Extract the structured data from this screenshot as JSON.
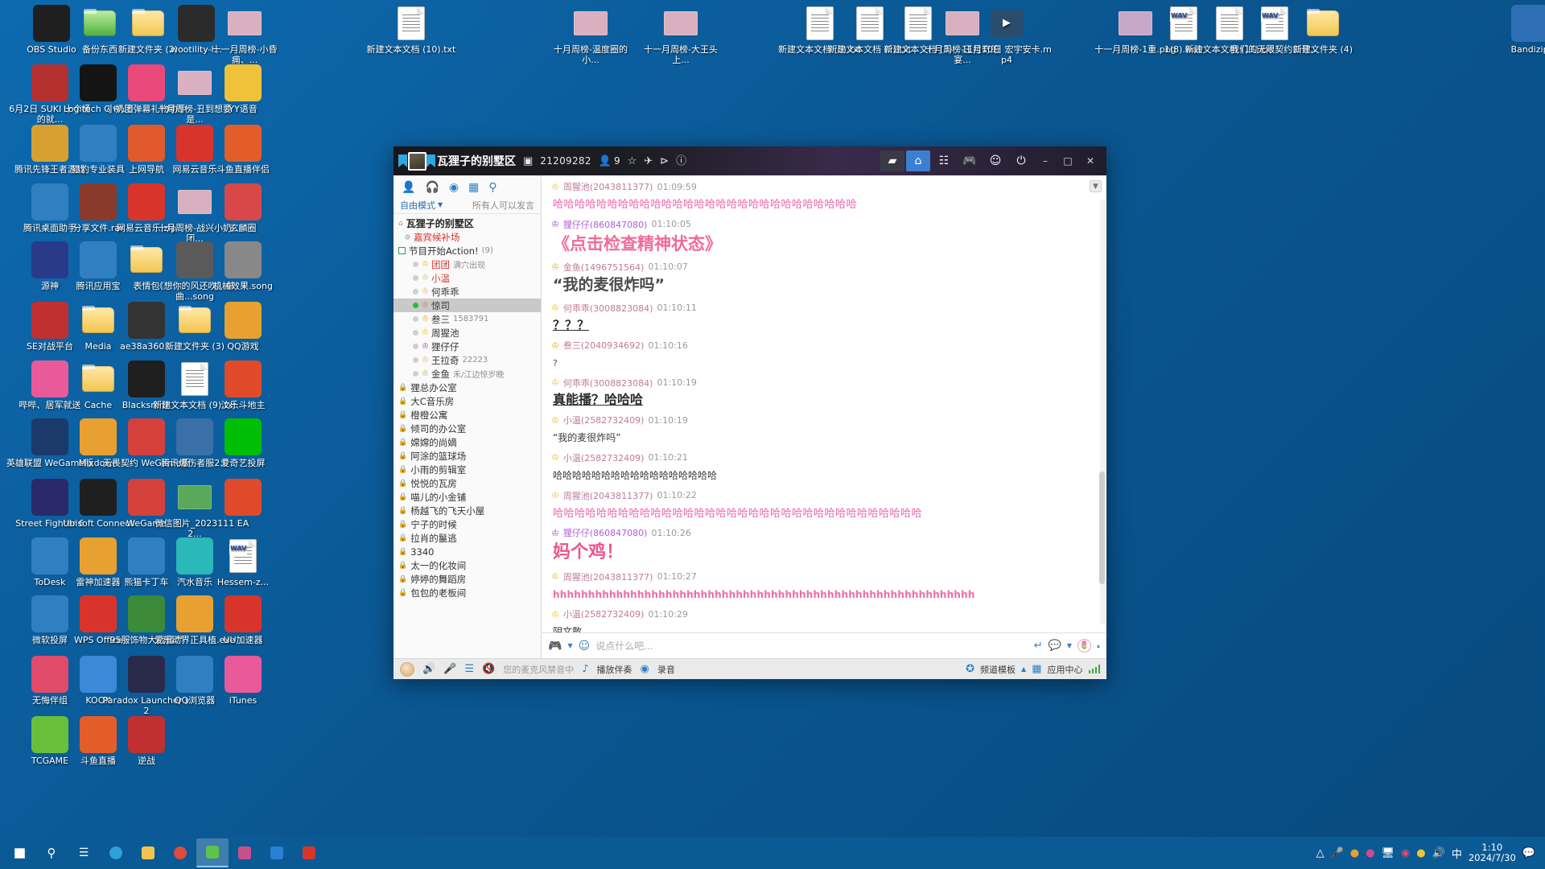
{
  "desktop": {
    "icons": [
      {
        "label": "OBS Studio",
        "type": "app",
        "color": "#1f1f1f"
      },
      {
        "label": "备份东西",
        "type": "folder-green"
      },
      {
        "label": "新建文件夹 (2)",
        "type": "folder"
      },
      {
        "label": "wootility-l...",
        "type": "app",
        "color": "#2b2b2b"
      },
      {
        "label": "十一月周榜-小昏痈、...",
        "type": "image",
        "color": "#d8b0c0"
      },
      {
        "label": "新建文本文档 (10).txt",
        "type": "txt"
      },
      {
        "label": "十月周榜-温度圈的小...",
        "type": "image",
        "color": "#d8b0c0"
      },
      {
        "label": "十一月周榜-大王头上...",
        "type": "image",
        "color": "#d8b0c0"
      },
      {
        "label": "新建文本文档 (5).txt",
        "type": "txt"
      },
      {
        "label": "新建文本文档 (2).txt",
        "type": "txt"
      },
      {
        "label": "新建文本文档 (3)",
        "type": "txt"
      },
      {
        "label": "十月周榜-王拉奇的宴...",
        "type": "image",
        "color": "#d8b0c0"
      },
      {
        "label": "11月10日 宏宇安卡.mp4",
        "type": "video",
        "color": "#2a4d6e"
      },
      {
        "label": "十一月周榜-1重.png",
        "type": "image",
        "color": "#c8a8c8"
      },
      {
        "label": "1(8).wav",
        "type": "wav"
      },
      {
        "label": "新建文本文档 (11).txt",
        "type": "txt"
      },
      {
        "label": "我们的无限契约口号...",
        "type": "wav"
      },
      {
        "label": "新建文件夹 (4)",
        "type": "folder"
      },
      {
        "label": "Bandizip",
        "type": "app",
        "color": "#2e6fb5"
      },
      {
        "label": "6月2日 SUKI 十个桶的就...",
        "type": "app",
        "color": "#b43030"
      },
      {
        "label": "Logitech G HUB",
        "type": "app",
        "color": "#141414"
      },
      {
        "label": "小奶团弹幕礼物助手",
        "type": "app",
        "color": "#e8487a"
      },
      {
        "label": "十月周榜-丑到想要是...",
        "type": "image",
        "color": "#d8b0c0"
      },
      {
        "label": "YY语音",
        "type": "app",
        "color": "#f0c23a"
      },
      {
        "label": "腾讯先锋王者游戏",
        "type": "app",
        "color": "#d8a030"
      },
      {
        "label": "猎豹专业装具",
        "type": "app",
        "color": "#2f7fc1"
      },
      {
        "label": "上网导航",
        "type": "app",
        "color": "#e05a2b"
      },
      {
        "label": "网易云音乐",
        "type": "app",
        "color": "#d9342b"
      },
      {
        "label": "斗鱼直播伴侣",
        "type": "app",
        "color": "#e35d2b"
      },
      {
        "label": "腾讯桌面助手",
        "type": "app",
        "color": "#2f7fc1"
      },
      {
        "label": "分享文件.rar",
        "type": "app",
        "color": "#8a3a2a"
      },
      {
        "label": "网易云音乐.zip",
        "type": "app",
        "color": "#d9342b"
      },
      {
        "label": "十月周榜-战兴小奶团...",
        "type": "image",
        "color": "#d8b0c0"
      },
      {
        "label": "玄麟圈",
        "type": "app",
        "color": "#d94848"
      },
      {
        "label": "源神",
        "type": "app",
        "color": "#2a3a8a"
      },
      {
        "label": "腾讯应用宝",
        "type": "app",
        "color": "#2f7fc1"
      },
      {
        "label": "表情包",
        "type": "folder"
      },
      {
        "label": "《想你的风还吹》单曲...song",
        "type": "app",
        "color": "#5a5a5a"
      },
      {
        "label": "机械效果.song",
        "type": "app",
        "color": "#888"
      },
      {
        "label": "SE对战平台",
        "type": "app",
        "color": "#c03030"
      },
      {
        "label": "Media",
        "type": "folder"
      },
      {
        "label": "ae38a360...",
        "type": "app",
        "color": "#333"
      },
      {
        "label": "新建文件夹 (3)",
        "type": "folder"
      },
      {
        "label": "QQ游戏",
        "type": "app",
        "color": "#e8a030"
      },
      {
        "label": "哔哔、居军就送",
        "type": "app",
        "color": "#e85a9a"
      },
      {
        "label": "Cache",
        "type": "folder"
      },
      {
        "label": "Blacksmith",
        "type": "app",
        "color": "#1f1f1f"
      },
      {
        "label": "新建文本文档 (9).txt",
        "type": "txt"
      },
      {
        "label": "汶乐斗地主",
        "type": "app",
        "color": "#e04a2b"
      },
      {
        "label": "英雄联盟 WeGame版",
        "type": "app",
        "color": "#1b3a6b"
      },
      {
        "label": "Mixdown",
        "type": "app",
        "color": "#e8a030"
      },
      {
        "label": "无畏契约 WeGame版",
        "type": "app",
        "color": "#d4403c"
      },
      {
        "label": "腾讯爆伤者服2.0",
        "type": "app",
        "color": "#3a6fa8"
      },
      {
        "label": "爱奇艺投屏",
        "type": "app",
        "color": "#00be06"
      },
      {
        "label": "Street Fighter 6",
        "type": "app",
        "color": "#2a2a6a"
      },
      {
        "label": "Ubisoft Connect",
        "type": "app",
        "color": "#1f1f1f"
      },
      {
        "label": "WeGame",
        "type": "app",
        "color": "#d4403c"
      },
      {
        "label": "微信图片_20231112...",
        "type": "image",
        "color": "#5aa85a"
      },
      {
        "label": "EA",
        "type": "app",
        "color": "#e04a2b"
      },
      {
        "label": "ToDesk",
        "type": "app",
        "color": "#2f7fc1"
      },
      {
        "label": "雷神加速器",
        "type": "app",
        "color": "#e8a030"
      },
      {
        "label": "熊猫卡丁车",
        "type": "app",
        "color": "#2f7fc1"
      },
      {
        "label": "汽水音乐",
        "type": "app",
        "color": "#2ab8b8"
      },
      {
        "label": "Hessem-z...",
        "type": "wav"
      },
      {
        "label": "微软投屏",
        "type": "app",
        "color": "#2f7fc1"
      },
      {
        "label": "WPS Office",
        "type": "app",
        "color": "#d9342b"
      },
      {
        "label": "95服饰物大战僵尸",
        "type": "app",
        "color": "#3a8a3a"
      },
      {
        "label": "爱乐动界正具植.exe",
        "type": "app",
        "color": "#e8a030"
      },
      {
        "label": "UU加速器",
        "type": "app",
        "color": "#d9342b"
      },
      {
        "label": "无悔伴组",
        "type": "app",
        "color": "#e04a6b"
      },
      {
        "label": "KOOK",
        "type": "app",
        "color": "#3a8ad8"
      },
      {
        "label": "Paradox Launcher v2",
        "type": "app",
        "color": "#2a2a4a"
      },
      {
        "label": "QQ浏览器",
        "type": "app",
        "color": "#2f7fc1"
      },
      {
        "label": "iTunes",
        "type": "app",
        "color": "#e85a9a"
      },
      {
        "label": "TCGAME",
        "type": "app",
        "color": "#6abf3a"
      },
      {
        "label": "斗鱼直播",
        "type": "app",
        "color": "#e35d2b"
      },
      {
        "label": "逆战",
        "type": "app",
        "color": "#c03030"
      }
    ]
  },
  "app": {
    "titlebar": {
      "room_name": "瓦狸子的别墅区",
      "room_id": "21209282",
      "member_icon": "person-icon",
      "member_count": "9",
      "icons": [
        "id-card-icon",
        "star-icon",
        "airplane-icon",
        "share-icon",
        "info-icon"
      ],
      "right_icons": [
        "screen-share-icon",
        "home-icon",
        "list-icon",
        "game-icon",
        "mask-icon",
        "power-icon"
      ],
      "window_controls": [
        "minimize",
        "maximize",
        "close"
      ]
    },
    "left_panel": {
      "tools": [
        "person-icon",
        "headphone-icon",
        "location-icon",
        "card-icon",
        "search-icon"
      ],
      "mode_label": "自由模式",
      "permission_label": "所有人可以发言",
      "tree": [
        {
          "level": 0,
          "name": "瓦狸子的别墅区",
          "style": "title",
          "marker": "home"
        },
        {
          "level": 1,
          "name": "嘉宾候补场",
          "style": "red",
          "marker": "dot"
        },
        {
          "level": 0,
          "name": "节目开始Action!",
          "style": "dark",
          "marker": "square",
          "suffix": "(9)"
        },
        {
          "level": 2,
          "name": "团团",
          "style": "red",
          "marker": "dot",
          "crown": "yellow",
          "tags": "满穴出现"
        },
        {
          "level": 2,
          "name": "小温",
          "style": "red",
          "marker": "dot",
          "crown": "yellow"
        },
        {
          "level": 2,
          "name": "何乖乖",
          "style": "dark",
          "marker": "dot",
          "crown": "yellow"
        },
        {
          "level": 2,
          "name": "惊司",
          "style": "dark",
          "marker": "dot-on",
          "crown": "orange",
          "selected": true
        },
        {
          "level": 2,
          "name": "叁三",
          "style": "dark",
          "marker": "dot",
          "crown": "gold",
          "suffix": "1583791"
        },
        {
          "level": 2,
          "name": "周猩池",
          "style": "dark",
          "marker": "dot",
          "crown": "yellow"
        },
        {
          "level": 2,
          "name": "狸仔仔",
          "style": "dark",
          "marker": "dot",
          "crown": "purple"
        },
        {
          "level": 2,
          "name": "王拉奇",
          "style": "dark",
          "marker": "dot",
          "crown": "yellow",
          "suffix": "22223"
        },
        {
          "level": 2,
          "name": "金鱼",
          "style": "dark",
          "marker": "dot",
          "crown": "gold",
          "suffix": "禾/江边惊岁晚"
        },
        {
          "level": 0,
          "name": "狸总办公室",
          "style": "dark",
          "marker": "lock"
        },
        {
          "level": 0,
          "name": "大C音乐房",
          "style": "dark",
          "marker": "lock"
        },
        {
          "level": 0,
          "name": "橙橙公寓",
          "style": "dark",
          "marker": "lock"
        },
        {
          "level": 0,
          "name": "倾司的办公室",
          "style": "dark",
          "marker": "lock"
        },
        {
          "level": 0,
          "name": "嫦嫦的尚嫡",
          "style": "dark",
          "marker": "lock"
        },
        {
          "level": 0,
          "name": "阿涂的篮球场",
          "style": "dark",
          "marker": "lock"
        },
        {
          "level": 0,
          "name": "小雨的剪辑室",
          "style": "dark",
          "marker": "lock"
        },
        {
          "level": 0,
          "name": "悦悦的瓦房",
          "style": "dark",
          "marker": "lock"
        },
        {
          "level": 0,
          "name": "喵儿的小金铺",
          "style": "dark",
          "marker": "lock"
        },
        {
          "level": 0,
          "name": "杨越飞的飞天小屋",
          "style": "dark",
          "marker": "lock"
        },
        {
          "level": 0,
          "name": "宁子的时候",
          "style": "dark",
          "marker": "lock"
        },
        {
          "level": 0,
          "name": "拉肖的鬣逃",
          "style": "dark",
          "marker": "lock"
        },
        {
          "level": 0,
          "name": "3340",
          "style": "dark",
          "marker": "lock"
        },
        {
          "level": 0,
          "name": "太一的化妆间",
          "style": "dark",
          "marker": "lock"
        },
        {
          "level": 0,
          "name": "婷婷的舞蹈房",
          "style": "dark",
          "marker": "lock"
        },
        {
          "level": 0,
          "name": "包包的老板间",
          "style": "dark",
          "marker": "lock"
        }
      ]
    },
    "chat": {
      "scroll_down_icon": "arrow-down-icon",
      "messages": [
        {
          "user": "周猩池",
          "uid": "2043811377",
          "time": "01:09:59",
          "avatar": "crown-yellow",
          "text": "哈哈哈哈哈哈哈哈哈哈哈哈哈哈哈哈哈哈哈哈哈哈哈哈哈哈哈哈",
          "style": "s-pinkbig"
        },
        {
          "user": "狸仔仔",
          "uid": "860847080",
          "time": "01:10:05",
          "avatar": "crown-purple",
          "text": "《点击检查精神状态》",
          "style": "s-titlepink"
        },
        {
          "user": "金鱼",
          "uid": "1496751564",
          "time": "01:10:07",
          "avatar": "crown-gold",
          "text": "“我的麦很炸吗”",
          "style": "s-bigdark"
        },
        {
          "user": "何乖乖",
          "uid": "3008823084",
          "time": "01:10:11",
          "avatar": "crown-yellow",
          "text": "？？？",
          "style": "s-uline"
        },
        {
          "user": "叁三",
          "uid": "2040934692",
          "time": "01:10:16",
          "avatar": "crown-gold",
          "text": "?",
          "style": "s-small"
        },
        {
          "user": "何乖乖",
          "uid": "3008823084",
          "time": "01:10:19",
          "avatar": "crown-yellow",
          "text": "真能播？哈哈哈",
          "style": "s-uline2"
        },
        {
          "user": "小温",
          "uid": "2582732409",
          "time": "01:10:19",
          "avatar": "crown-yellow",
          "text": "“我的麦很炸吗”",
          "style": "s-norm"
        },
        {
          "user": "小温",
          "uid": "2582732409",
          "time": "01:10:21",
          "avatar": "crown-yellow",
          "text": "哈哈哈哈哈哈哈哈哈哈哈哈哈哈哈哈哈",
          "style": "s-norm"
        },
        {
          "user": "周猩池",
          "uid": "2043811377",
          "time": "01:10:22",
          "avatar": "crown-yellow",
          "text": "哈哈哈哈哈哈哈哈哈哈哈哈哈哈哈哈哈哈哈哈哈哈哈哈哈哈哈哈哈哈哈哈哈哈",
          "style": "s-pinkbig"
        },
        {
          "user": "狸仔仔",
          "uid": "860847080",
          "time": "01:10:26",
          "avatar": "crown-purple",
          "text": "妈个鸡！",
          "style": "s-redbig"
        },
        {
          "user": "周猩池",
          "uid": "2043811377",
          "time": "01:10:27",
          "avatar": "crown-yellow",
          "text": "hhhhhhhhhhhhhhhhhhhhhhhhhhhhhhhhhhhhhhhhhhhhhhhhhhhhhhhhhhhh",
          "style": "s-hpink"
        },
        {
          "user": "小温",
          "uid": "2582732409",
          "time": "01:10:29",
          "avatar": "crown-yellow",
          "text": "阴文散",
          "style": "s-norm"
        }
      ]
    },
    "input": {
      "placeholder": "说点什么吧...",
      "value": "",
      "left_icons": [
        "game-emoji-icon",
        "face-icon"
      ],
      "right_icons": [
        "enter-icon",
        "emoji-icon",
        "flower-icon",
        "collapse-icon"
      ]
    },
    "statusbar": {
      "avatar": "user-avatar",
      "icons": [
        "speaker-icon",
        "mic-muted-icon",
        "equalizer-icon"
      ],
      "mic_status": "您的麦克风禁音中",
      "play_accompaniment": "播放伴奏",
      "record": "录音",
      "channel_template": "频道模板",
      "app_center": "应用中心",
      "signal_icon": "signal-bars-icon"
    }
  },
  "taskbar": {
    "start_icon": "windows-start-icon",
    "items": [
      "search-icon",
      "taskview-icon",
      "edge-icon",
      "folder-icon",
      "chrome-icon",
      "qt-voice-icon",
      "app-icon-1",
      "app-icon-2",
      "app-icon-3"
    ],
    "tray_icons": [
      "chevron-up-icon",
      "microphone-icon",
      "chrome-tray-icon",
      "clock-tray-icon",
      "network-icon",
      "obs-tray-icon",
      "app-tray-icon",
      "volume-icon"
    ],
    "ime_label": "中",
    "clock_time": "1:10",
    "clock_date": "2024/7/30",
    "notification_icon": "notification-icon"
  }
}
